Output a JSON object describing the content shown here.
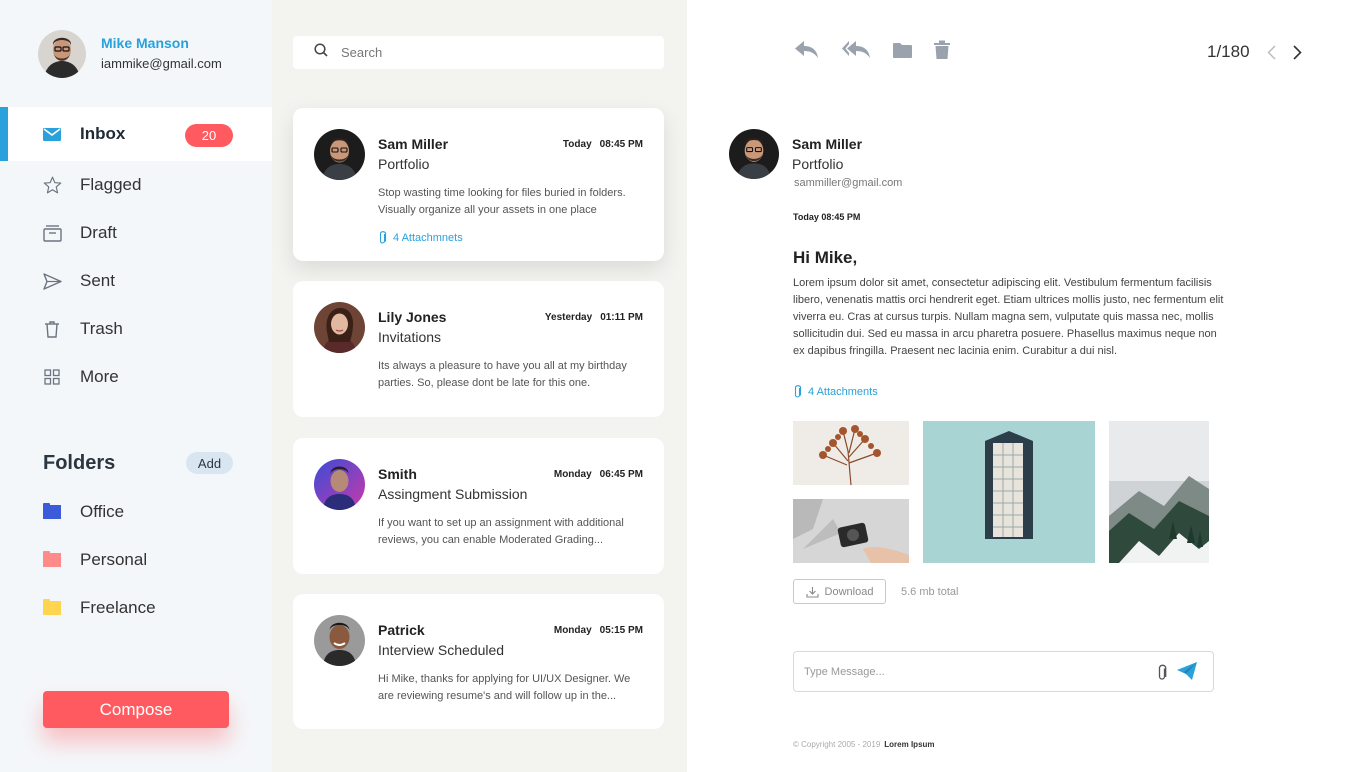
{
  "user": {
    "name": "Mike Manson",
    "email": "iammike@gmail.com"
  },
  "nav": [
    {
      "label": "Inbox",
      "icon": "mail-icon",
      "badge": "20",
      "active": true
    },
    {
      "label": "Flagged",
      "icon": "star-icon"
    },
    {
      "label": "Draft",
      "icon": "draft-box-icon"
    },
    {
      "label": "Sent",
      "icon": "send-icon"
    },
    {
      "label": "Trash",
      "icon": "trash-icon"
    },
    {
      "label": "More",
      "icon": "grid-icon"
    }
  ],
  "folders": {
    "title": "Folders",
    "add_label": "Add",
    "items": [
      {
        "label": "Office",
        "color": "#3b5bdb"
      },
      {
        "label": "Personal",
        "color": "#ff8a8a"
      },
      {
        "label": "Freelance",
        "color": "#ffd54f"
      }
    ]
  },
  "compose_label": "Compose",
  "search": {
    "placeholder": "Search"
  },
  "messages": [
    {
      "name": "Sam Miller",
      "subject": "Portfolio",
      "day": "Today",
      "time": "08:45 PM",
      "preview": "Stop wasting time looking for files buried in folders. Visually organize all your assets in one place",
      "attachments": "4 Attachmnets"
    },
    {
      "name": "Lily Jones",
      "subject": "Invitations",
      "day": "Yesterday",
      "time": "01:11 PM",
      "preview": "Its always a pleasure to have you all at my birthday parties. So, please dont be late for this one."
    },
    {
      "name": "Smith",
      "subject": "Assingment Submission",
      "day": "Monday",
      "time": "06:45 PM",
      "preview": "If you want to set up an assignment with additional reviews, you can enable Moderated Grading..."
    },
    {
      "name": "Patrick",
      "subject": "Interview Scheduled",
      "day": "Monday",
      "time": "05:15 PM",
      "preview": "Hi Mike, thanks for applying for UI/UX Designer. We are reviewing resume's and will follow up in the..."
    }
  ],
  "reader": {
    "pager": "1/180",
    "sender_name": "Sam Miller",
    "subject": "Portfolio",
    "sender_email": "sammiller@gmail.com",
    "date": "Today 08:45 PM",
    "greeting": "Hi Mike,",
    "body": "Lorem ipsum dolor sit amet, consectetur adipiscing elit. Vestibulum fermentum facilisis libero, venenatis mattis orci hendrerit eget. Etiam ultrices mollis justo, nec fermentum elit viverra eu. Cras at cursus turpis. Nullam magna sem, vulputate quis massa nec, mollis sollicitudin dui. Sed eu massa in arcu pharetra posuere. Phasellus maximus neque non ex dapibus fringilla. Praesent nec lacinia enim. Curabitur a dui nisl.",
    "attachments": "4 Attachments",
    "download_label": "Download",
    "total_size": "5.6 mb total",
    "message_placeholder": "Type Message...",
    "copyright": "© Copyright 2005 - 2019",
    "brand": "Lorem Ipsum"
  },
  "colors": {
    "accent": "#2aa1da",
    "danger": "#ff5a5f",
    "list_bg": "#f3f3ef",
    "sidebar_bg": "#f4f7fa"
  }
}
